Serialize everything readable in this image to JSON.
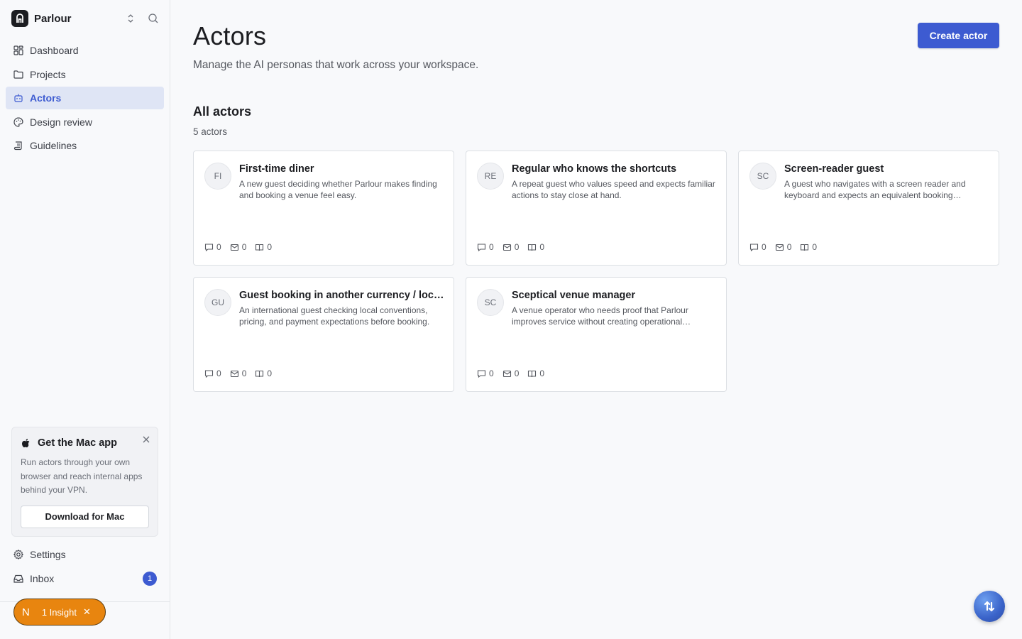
{
  "workspace": {
    "name": "Parlour"
  },
  "sidebar": {
    "items": [
      {
        "label": "Dashboard",
        "icon": "dashboard-icon"
      },
      {
        "label": "Projects",
        "icon": "folder-icon"
      },
      {
        "label": "Actors",
        "icon": "robot-icon",
        "active": true
      },
      {
        "label": "Design review",
        "icon": "palette-icon"
      },
      {
        "label": "Guidelines",
        "icon": "scroll-icon"
      }
    ],
    "promo": {
      "title": "Get the Mac app",
      "body": "Run actors through your own browser and reach internal apps behind your VPN.",
      "button": "Download for Mac"
    },
    "bottom_items": [
      {
        "label": "Settings",
        "icon": "gear-icon"
      },
      {
        "label": "Inbox",
        "icon": "inbox-icon",
        "badge": "1"
      }
    ],
    "insight": {
      "label": "1 Insight",
      "glyph": "N"
    }
  },
  "header": {
    "title": "Actors",
    "subtitle": "Manage the AI personas that work across your workspace.",
    "create_label": "Create actor"
  },
  "section": {
    "title": "All actors",
    "count": "5 actors"
  },
  "actors": [
    {
      "initials": "FI",
      "name": "First-time diner",
      "description": "A new guest deciding whether Parlour makes finding and booking a venue feel easy.",
      "comments": "0",
      "messages": "0",
      "books": "0"
    },
    {
      "initials": "RE",
      "name": "Regular who knows the shortcuts",
      "description": "A repeat guest who values speed and expects familiar actions to stay close at hand.",
      "comments": "0",
      "messages": "0",
      "books": "0"
    },
    {
      "initials": "SC",
      "name": "Screen-reader guest",
      "description": "A guest who navigates with a screen reader and keyboard and expects an equivalent booking experience.",
      "comments": "0",
      "messages": "0",
      "books": "0"
    },
    {
      "initials": "GU",
      "name": "Guest booking in another currency / locale",
      "description": "An international guest checking local conventions, pricing, and payment expectations before booking.",
      "comments": "0",
      "messages": "0",
      "books": "0"
    },
    {
      "initials": "SC",
      "name": "Sceptical venue manager",
      "description": "A venue operator who needs proof that Parlour improves service without creating operational overhead.",
      "comments": "0",
      "messages": "0",
      "books": "0"
    }
  ],
  "colors": {
    "accent": "#3d5bd1",
    "insight": "#e8850f",
    "active_bg": "#dfe5f5"
  }
}
